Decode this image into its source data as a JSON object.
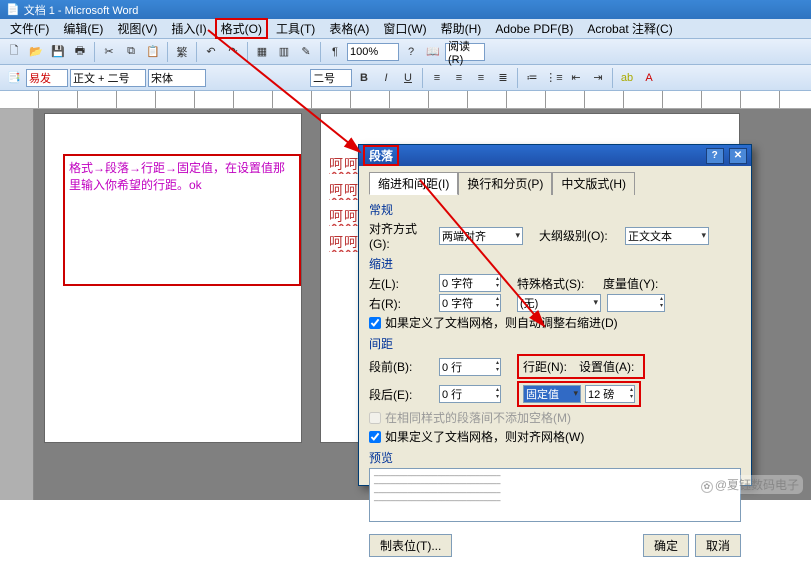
{
  "window": {
    "title": "文档 1 - Microsoft Word"
  },
  "menu": {
    "items": [
      "文件(F)",
      "编辑(E)",
      "视图(V)",
      "插入(I)",
      "格式(O)",
      "工具(T)",
      "表格(A)",
      "窗口(W)",
      "帮助(H)",
      "Adobe PDF(B)",
      "Acrobat 注释(C)"
    ],
    "highlightIndex": 4
  },
  "toolbar1": {
    "zoom": "100%",
    "btn_lang": "繁"
  },
  "toolbar2": {
    "outline_btn": "易发",
    "style": "正文 + 二号",
    "font": "宋体",
    "size": "二号"
  },
  "annotation": {
    "text": "格式→段落→行距→固定值，在设置值那里输入你希望的行距。ok"
  },
  "docSample": {
    "rows": [
      "呵呵呵呵和呵呵",
      "呵呵呵呵和呵呵",
      "呵呵和呵呵呵呵",
      "呵呵和"
    ]
  },
  "dialog": {
    "title": "段落",
    "helpGlyph": "?",
    "closeGlyph": "✕",
    "tabs": [
      "缩进和间距(I)",
      "换行和分页(P)",
      "中文版式(H)"
    ],
    "activeTab": 0,
    "section_general": "常规",
    "align_label": "对齐方式(G):",
    "align_value": "两端对齐",
    "outline_label": "大纲级别(O):",
    "outline_value": "正文文本",
    "section_indent": "缩进",
    "left_label": "左(L):",
    "left_value": "0 字符",
    "right_label": "右(R):",
    "right_value": "0 字符",
    "special_label": "特殊格式(S):",
    "special_value": "(无)",
    "by_label": "度量值(Y):",
    "by_value": "",
    "auto_adjust_chk": "如果定义了文档网格，则自动调整右缩进(D)",
    "section_spacing": "间距",
    "before_label": "段前(B):",
    "before_value": "0 行",
    "after_label": "段后(E):",
    "after_value": "0 行",
    "linespace_label": "行距(N):",
    "linespace_value": "固定值",
    "at_label": "设置值(A):",
    "at_value": "12 磅",
    "no_space_chk": "在相同样式的段落间不添加空格(M)",
    "snap_chk": "如果定义了文档网格，则对齐网格(W)",
    "preview_label": "预览",
    "tabs_btn": "制表位(T)...",
    "ok_btn": "确定",
    "cancel_btn": "取消"
  },
  "watermark": {
    "text": "@夏钰数码电子"
  }
}
